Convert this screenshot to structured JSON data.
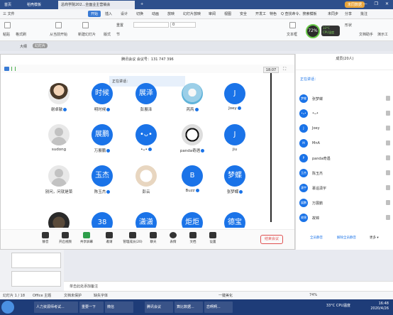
{
  "titlebar": {
    "tabs": [
      "首页",
      "稻壳模板",
      "总商学院202...全面业主营销会",
      "+"
    ],
    "account": "未同数据",
    "winctl": "— ❐ ✕"
  },
  "menubar": {
    "items": [
      "三 文件",
      "开始",
      "插入",
      "设计",
      "切换",
      "动画",
      "放映",
      "幻灯片放映",
      "审阅",
      "视图",
      "安全",
      "开发工",
      "特色",
      "Q 查找命令、搜索模板",
      "未同步",
      "分享",
      "批注"
    ]
  },
  "ribbon": {
    "paste": "粘贴",
    "format": "格式刷",
    "from_current": "从当前开始",
    "new_slide": "新建幻灯片",
    "layout": "版式",
    "reset": "重置",
    "section": "节",
    "font_size": "0",
    "textbox": "文本框",
    "shape": "形状",
    "doc_assist": "文档助手",
    "deploy": "演示工",
    "gauge": "72%",
    "gauge_temp": "33°C",
    "gauge_cpu": "CPU温度"
  },
  "slidebar": {
    "label": "大纲",
    "tab": "幻灯片"
  },
  "meeting": {
    "title": "腾讯会议  会议号：131 747 396",
    "timer": "18:07",
    "speaking_popup": "正在讲话：",
    "participants": [
      {
        "name": "谢卓敏",
        "avatar": "",
        "style": "photo1",
        "mic": true
      },
      {
        "name": "明时候",
        "avatar": "时候",
        "style": "blue",
        "mic": true
      },
      {
        "name": "彭展泽",
        "avatar": "展泽",
        "style": "blue",
        "mic": false
      },
      {
        "name": "芮芮",
        "avatar": "",
        "style": "photo2",
        "mic": true
      },
      {
        "name": "Joey",
        "avatar": "J",
        "style": "blue",
        "mic": true
      },
      {
        "name": "sudong",
        "avatar": "",
        "style": "gray",
        "mic": false
      },
      {
        "name": "万展鹏",
        "avatar": "展鹏",
        "style": "blue",
        "mic": true
      },
      {
        "name": "•ᴗ•",
        "avatar": "•ᴗ•",
        "style": "blue",
        "mic": true
      },
      {
        "name": "panda奇遇",
        "avatar": "",
        "style": "panda",
        "mic": true
      },
      {
        "name": "jiu",
        "avatar": "J",
        "style": "blue",
        "mic": false
      },
      {
        "name": "别问，问就是菜",
        "avatar": "",
        "style": "gray",
        "mic": false
      },
      {
        "name": "陈玉杰",
        "avatar": "玉杰",
        "style": "blue",
        "mic": true
      },
      {
        "name": "彭云",
        "avatar": "",
        "style": "cat",
        "mic": false
      },
      {
        "name": "Buzz",
        "avatar": "B",
        "style": "blue",
        "mic": true
      },
      {
        "name": "张梦蝶",
        "avatar": "梦蝶",
        "style": "blue",
        "mic": true
      }
    ],
    "partial_row": [
      "",
      "38",
      "潇潇",
      "炬炬",
      "德宝"
    ],
    "toolbar": [
      {
        "label": "静音",
        "name": "mute"
      },
      {
        "label": "开启视频",
        "name": "video"
      },
      {
        "label": "共享屏幕",
        "name": "share"
      },
      {
        "label": "邀请",
        "name": "invite"
      },
      {
        "label": "管理成员(20)",
        "name": "members"
      },
      {
        "label": "聊天",
        "name": "chat"
      },
      {
        "label": "表情",
        "name": "emoji"
      },
      {
        "label": "文档",
        "name": "docs"
      },
      {
        "label": "设置",
        "name": "settings"
      }
    ],
    "end_button": "结束会议"
  },
  "members_panel": {
    "header": "成员(20人)",
    "speaking": "正在讲话：",
    "rows": [
      {
        "name": "张梦蝶",
        "avatar": "梦蝶"
      },
      {
        "name": "•ᴗ•",
        "avatar": "•ᴗ•"
      },
      {
        "name": "Joey",
        "avatar": "J"
      },
      {
        "name": "MnA",
        "avatar": "M"
      },
      {
        "name": "panda奇遇",
        "avatar": "P"
      },
      {
        "name": "陈玉杰",
        "avatar": "玉杰"
      },
      {
        "name": "慕遥潇宇",
        "avatar": "潇宇"
      },
      {
        "name": "万展鹏",
        "avatar": "展鹏"
      },
      {
        "name": "故锦",
        "avatar": "故锦"
      }
    ],
    "mute_all": "全员静音",
    "unmute_all": "解除全员静音",
    "more": "更多 ▾"
  },
  "notes": {
    "placeholder": "单击此处添加备注"
  },
  "statusbar": {
    "slide": "幻灯片 1 / 18",
    "theme": "Office 主题",
    "protect": "文档未保护",
    "font": "缺失字体",
    "beautify": "一键美化",
    "zoom": "74%"
  },
  "taskbar": {
    "items": [
      "人力资源师考试...",
      "重要一下",
      "微信",
      "腾讯会议",
      "算比数据...",
      "恋啊啊..."
    ],
    "temp": "33°C",
    "cpu": "CPU温度",
    "time": "16:48",
    "date": "2020/4/26"
  },
  "colors": {
    "accent": "#1a73e8",
    "titlebar": "#2d4f8c",
    "taskbar": "#1e3c78",
    "danger": "#e05050"
  }
}
